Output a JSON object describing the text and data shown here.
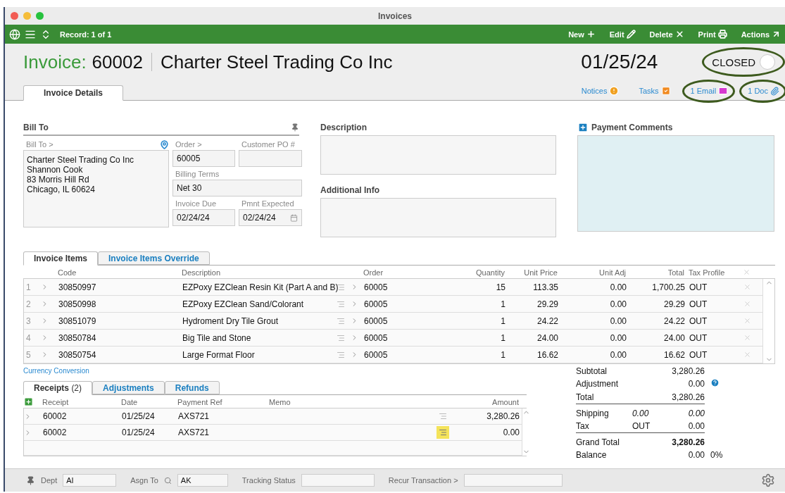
{
  "window": {
    "title": "Invoices"
  },
  "toolbar": {
    "record": "Record: 1 of 1",
    "actions": [
      {
        "label": "New",
        "kind": "new"
      },
      {
        "label": "Edit",
        "kind": "edit"
      },
      {
        "label": "Delete",
        "kind": "delete"
      },
      {
        "label": "Print",
        "kind": "print"
      },
      {
        "label": "Actions",
        "kind": "actions"
      }
    ]
  },
  "header": {
    "label": "Invoice:",
    "number": "60002",
    "customer": "Charter Steel Trading Co Inc",
    "date": "01/25/24",
    "status": {
      "label": "CLOSED",
      "on": false,
      "circled": true
    }
  },
  "tabs": [
    {
      "label": "Invoice Details",
      "selected": true
    }
  ],
  "links": [
    {
      "label": "Notices",
      "kind": "notices",
      "circled": false
    },
    {
      "label": "Tasks",
      "kind": "tasks",
      "circled": false
    },
    {
      "label": "1 Email",
      "kind": "email",
      "circled": true
    },
    {
      "label": "1 Doc",
      "kind": "doc",
      "circled": true
    }
  ],
  "bill_to": {
    "heading": "Bill To",
    "label": "Bill To >",
    "address_lines": [
      "Charter Steel Trading Co Inc",
      "Shannon Cook",
      "83 Morris Hill Rd",
      "Chicago, IL 60624"
    ],
    "fields": [
      {
        "label": "Order >",
        "value": "60005"
      },
      {
        "label": "Customer PO #"
      },
      {
        "label": "Billing Terms",
        "value": "Net 30"
      },
      {
        "label": "Invoice Due",
        "value": "02/24/24"
      },
      {
        "label": "Pmnt Expected",
        "value": "02/24/24"
      }
    ]
  },
  "description": {
    "heading": "Description"
  },
  "additional_info": {
    "heading": "Additional Info"
  },
  "payment_comments": {
    "heading": "Payment Comments"
  },
  "item_tabs": [
    {
      "label": "Invoice Items",
      "selected": true
    },
    {
      "label": "Invoice Items Override",
      "selected": false
    }
  ],
  "items": {
    "columns": [
      "Code",
      "Description",
      "Order",
      "Quantity",
      "Unit Price",
      "Unit Adj",
      "Total",
      "Tax Profile"
    ],
    "rows": [
      {
        "num": "1",
        "code": "30850997",
        "description": "EZPoxy EZClean Resin Kit (Part A and B)",
        "order": "60005",
        "quantity": "15",
        "unit_price": "113.35",
        "unit_adj": "0.00",
        "total": "1,700.25",
        "tax": "OUT"
      },
      {
        "num": "2",
        "code": "30850998",
        "description": "EZPoxy EZClean Sand/Colorant",
        "order": "60005",
        "quantity": "1",
        "unit_price": "29.29",
        "unit_adj": "0.00",
        "total": "29.29",
        "tax": "OUT"
      },
      {
        "num": "3",
        "code": "30851079",
        "description": "Hydroment Dry Tile Grout",
        "order": "60005",
        "quantity": "1",
        "unit_price": "24.22",
        "unit_adj": "0.00",
        "total": "24.22",
        "tax": "OUT"
      },
      {
        "num": "4",
        "code": "30850784",
        "description": "Big Tile and Stone",
        "order": "60005",
        "quantity": "1",
        "unit_price": "24.00",
        "unit_adj": "0.00",
        "total": "24.00",
        "tax": "OUT"
      },
      {
        "num": "5",
        "code": "30850754",
        "description": "Large Format Floor",
        "order": "60005",
        "quantity": "1",
        "unit_price": "16.62",
        "unit_adj": "0.00",
        "total": "16.62",
        "tax": "OUT"
      }
    ]
  },
  "currency_link": "Currency Conversion",
  "receipt_tabs": [
    {
      "label": "Receipts",
      "count": "(2)",
      "selected": true
    },
    {
      "label": "Adjustments",
      "selected": false
    },
    {
      "label": "Refunds",
      "selected": false
    }
  ],
  "receipts": {
    "columns": [
      "Receipt",
      "Date",
      "Payment Ref",
      "Memo",
      "Amount"
    ],
    "rows": [
      {
        "receipt": "60002",
        "date": "01/25/24",
        "payment_ref": "AXS721",
        "amount": "3,280.26",
        "note_highlighted": false
      },
      {
        "receipt": "60002",
        "date": "01/25/24",
        "payment_ref": "AXS721",
        "amount": "0.00",
        "note_highlighted": true
      }
    ]
  },
  "totals": [
    {
      "label": "Subtotal",
      "value": "3,280.26"
    },
    {
      "label": "Adjustment",
      "value": "0.00",
      "help": true
    },
    {
      "label": "Total",
      "value": "3,280.26",
      "rule": true
    },
    {
      "label": "Shipping",
      "middle": "0.00",
      "value": "0.00",
      "italic": true
    },
    {
      "label": "Tax",
      "middle": "OUT",
      "value": "0.00",
      "rule": true
    },
    {
      "label": "Grand Total",
      "value": "3,280.26",
      "bold": true
    },
    {
      "label": "Balance",
      "value": "0.00",
      "extra": "0%"
    }
  ],
  "footer": [
    {
      "label": "Dept",
      "value": "AI"
    },
    {
      "label": "Asgn To",
      "value": "AK",
      "search": true
    },
    {
      "label": "Tracking Status"
    },
    {
      "label": "Recur Transaction >"
    }
  ]
}
